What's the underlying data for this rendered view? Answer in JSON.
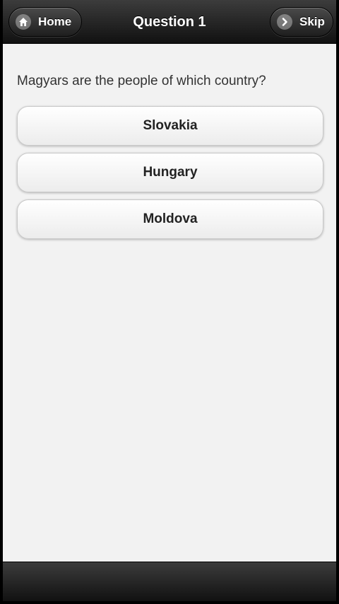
{
  "header": {
    "title": "Question 1",
    "home_label": "Home",
    "home_icon": "home-icon",
    "skip_label": "Skip",
    "skip_icon": "chevron-right-icon"
  },
  "question": {
    "text": "Magyars are the people of which country?"
  },
  "answers": [
    {
      "label": "Slovakia"
    },
    {
      "label": "Hungary"
    },
    {
      "label": "Moldova"
    }
  ],
  "colors": {
    "bar_dark": "#111111",
    "bar_light": "#3c3c3c",
    "page_bg": "#f2f2f2",
    "button_bg": "#ffffff"
  }
}
